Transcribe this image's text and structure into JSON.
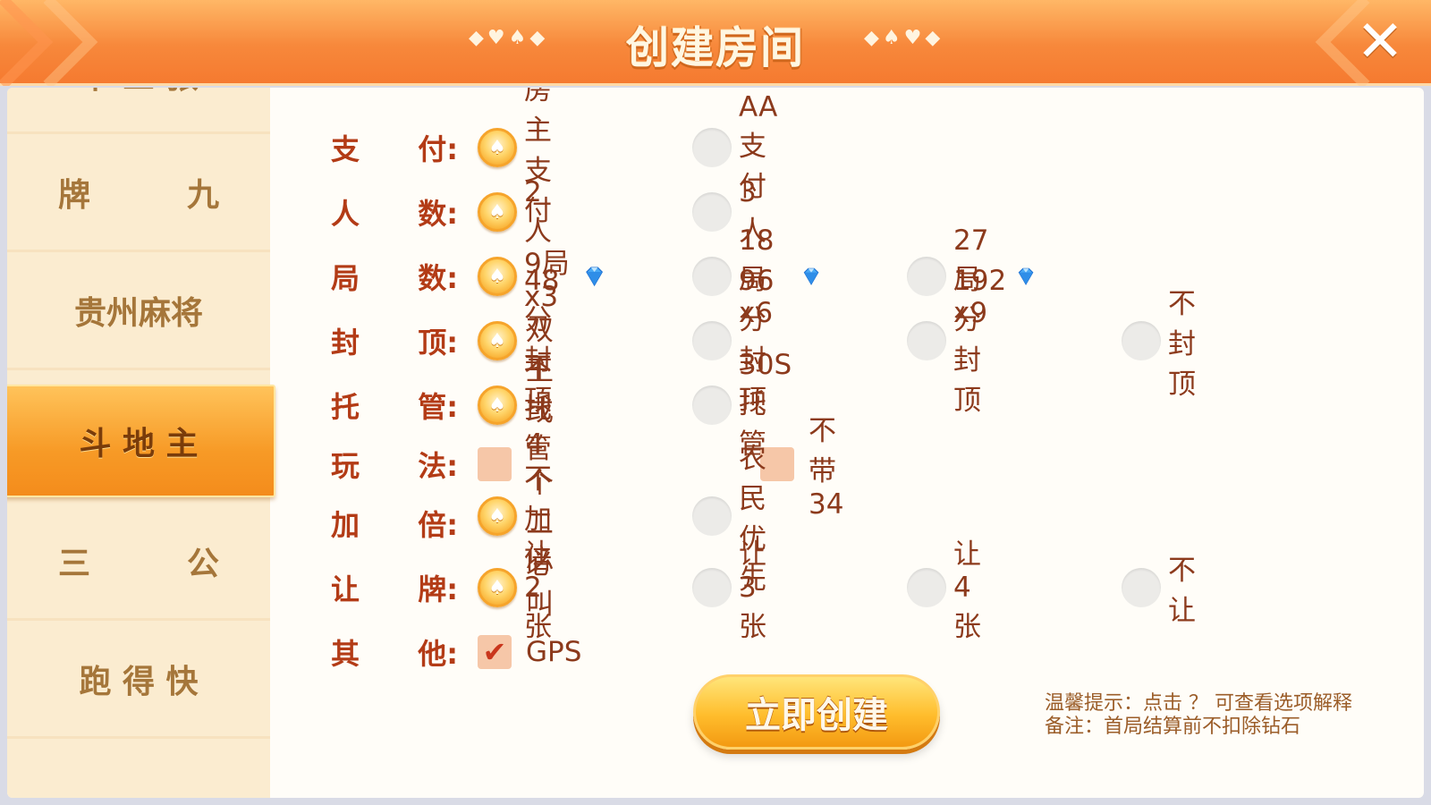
{
  "header": {
    "title": "创建房间",
    "suits_left": "◆♥♠◆",
    "suits_right": "◆♠♥◆",
    "close_icon": "close-icon"
  },
  "sidebar": {
    "items": [
      {
        "label": "十 三 张",
        "selected": false
      },
      {
        "label": "牌　　　九",
        "selected": false
      },
      {
        "label": "贵州麻将",
        "selected": false
      },
      {
        "label": "斗 地 主",
        "selected": true
      },
      {
        "label": "三　　　公",
        "selected": false
      },
      {
        "label": "跑 得 快",
        "selected": false
      }
    ]
  },
  "settings": {
    "pay": {
      "label_a": "支",
      "label_b": "付:",
      "options": [
        "房主支付",
        "AA支付"
      ],
      "selected": 0
    },
    "players": {
      "label_a": "人",
      "label_b": "数:",
      "options": [
        "2人",
        "3人"
      ],
      "selected": 0
    },
    "rounds": {
      "label_a": "局",
      "label_b": "数:",
      "options": [
        "9局x3",
        "18局x6",
        "27局x9"
      ],
      "selected": 0
    },
    "cap": {
      "label_a": "封",
      "label_b": "顶:",
      "options": [
        "48分封顶",
        "96分封顶",
        "192分封顶",
        "不封顶"
      ],
      "selected": 0
    },
    "hosting": {
      "label_a": "托",
      "label_b": "管:",
      "options": [
        "不托管",
        "30S托管"
      ],
      "selected": 0
    },
    "rules": {
      "label_a": "玩",
      "label_b": "法:",
      "options": [
        "双王或4个二必叫",
        "不带34"
      ],
      "checked": [
        false,
        false
      ]
    },
    "double": {
      "label_a": "加",
      "label_b": "倍:",
      "options": [
        "不加倍",
        "农民优先"
      ],
      "selected": 0
    },
    "concede": {
      "label_a": "让",
      "label_b": "牌:",
      "options": [
        "让2张",
        "让3张",
        "让4张",
        "不让"
      ],
      "selected": 0
    },
    "other": {
      "label_a": "其",
      "label_b": "他:",
      "options": [
        "GPS"
      ],
      "checked": [
        true
      ]
    }
  },
  "create_button": "立即创建",
  "tips": {
    "line1": "温馨提示：点击 ？ 可查看选项解释",
    "line2": "备注：首局结算前不扣除钻石"
  },
  "colors": {
    "accent": "#f79a26",
    "label": "#b33b16",
    "text": "#8c3a1c"
  }
}
